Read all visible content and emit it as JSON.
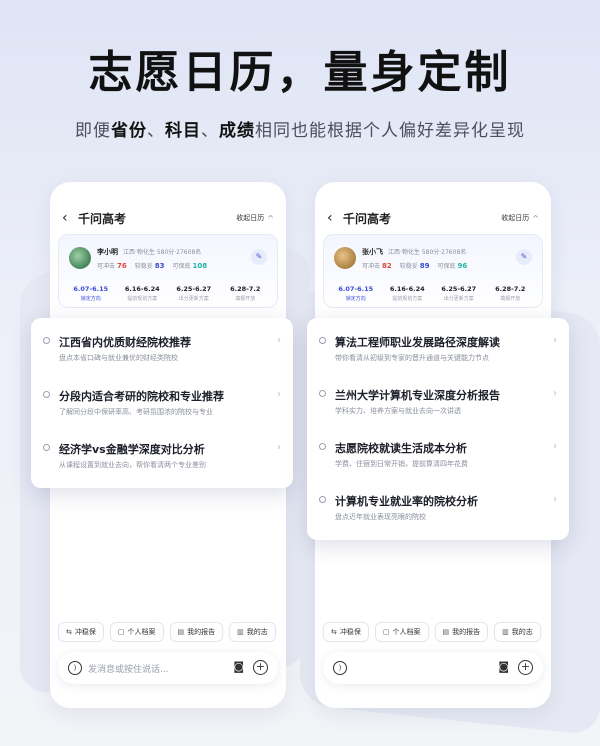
{
  "hero": {
    "title": "志愿日历，量身定制",
    "subtitle_parts": [
      "即便",
      "省份",
      "、",
      "科目",
      "、",
      "成绩",
      "相同也能根据个人偏好差异化呈现"
    ]
  },
  "phones": [
    {
      "nav_title": "千问高考",
      "collapse_label": "收起日历",
      "profile": {
        "name": "李小明",
        "meta": "江西·物化生   580分·27608名",
        "scores": [
          {
            "label": "可冲击",
            "value": "76"
          },
          {
            "label": "较稳妥",
            "value": "83"
          },
          {
            "label": "可保底",
            "value": "108"
          }
        ]
      },
      "dates": [
        {
          "date": "6.07-6.15",
          "label": "锁定方向"
        },
        {
          "date": "6.16-6.24",
          "label": "提前规划方案"
        },
        {
          "date": "6.25-6.27",
          "label": "出分更新方案"
        },
        {
          "date": "6.28-7.2",
          "label": "填报开放"
        }
      ],
      "items": [
        {
          "title": "江西省内优质财经院校推荐",
          "sub": "盘点本省口碑与就业兼优的财经类院校"
        },
        {
          "title": "分段内适合考研的院校和专业推荐",
          "sub": "了解同分段中保研率高、考研氛围浓的院校与专业"
        },
        {
          "title": "经济学vs金融学深度对比分析",
          "sub": "从课程设置到就业去向，帮你看清两个专业差别"
        }
      ],
      "chips": [
        "冲稳保",
        "个人档案",
        "我的报告",
        "我的志"
      ],
      "input_placeholder": "发消息或按住说话..."
    },
    {
      "nav_title": "千问高考",
      "collapse_label": "收起日历",
      "profile": {
        "name": "张小飞",
        "meta": "江西·物化生   580分·27608名",
        "scores": [
          {
            "label": "可冲击",
            "value": "82"
          },
          {
            "label": "较稳妥",
            "value": "89"
          },
          {
            "label": "可保底",
            "value": "96"
          }
        ]
      },
      "dates": [
        {
          "date": "6.07-6.15",
          "label": "锁定方向"
        },
        {
          "date": "6.16-6.24",
          "label": "提前规划方案"
        },
        {
          "date": "6.25-6.27",
          "label": "出分更新方案"
        },
        {
          "date": "6.28-7.2",
          "label": "填报开放"
        }
      ],
      "items": [
        {
          "title": "算法工程师职业发展路径深度解读",
          "sub": "带你看清从初级到专家的晋升通道与关键能力节点"
        },
        {
          "title": "兰州大学计算机专业深度分析报告",
          "sub": "学科实力、培养方案与就业去向一次讲透"
        },
        {
          "title": "志愿院校就读生活成本分析",
          "sub": "学费、住宿到日常开销，提前算清四年花费"
        },
        {
          "title": "计算机专业就业率的院校分析",
          "sub": "盘点近年就业表现亮眼的院校"
        }
      ],
      "chips": [
        "冲稳保",
        "个人档案",
        "我的报告",
        "我的志"
      ],
      "input_placeholder": ""
    }
  ],
  "colors": {
    "accent": "#3d4ad8",
    "red": "#e0463c",
    "teal": "#1fb3a4"
  }
}
